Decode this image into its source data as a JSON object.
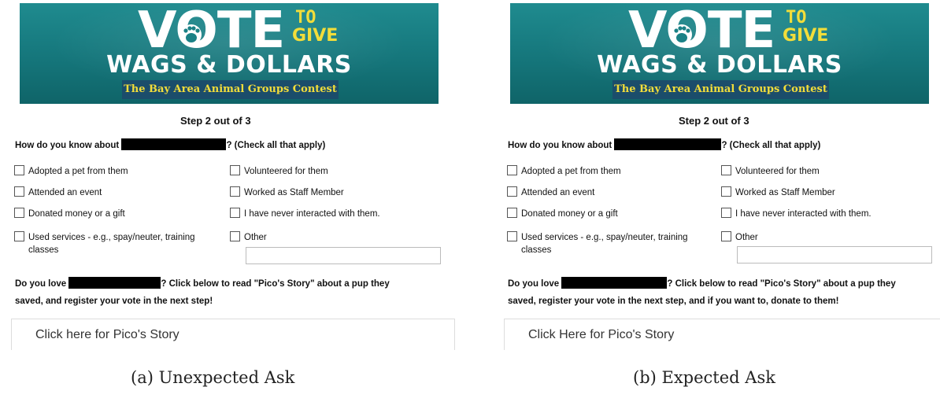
{
  "panels": [
    {
      "banner": {
        "vote": "VOTE",
        "to": "TO",
        "give": "GIVE",
        "wags": "WAGS & DOLLARS",
        "contest": "The Bay Area Animal Groups Contest"
      },
      "step": "Step 2 out of 3",
      "question_before": "How do you know about",
      "question_after": "? (Check all that apply)",
      "options_left": [
        {
          "label": "Adopted a pet from them"
        },
        {
          "label": "Attended an event"
        },
        {
          "label": "Donated money or a gift"
        },
        {
          "label": "Used services - e.g., spay/neuter, training",
          "cont": "classes"
        }
      ],
      "options_right": [
        {
          "label": "Volunteered for them"
        },
        {
          "label": "Worked as Staff Member"
        },
        {
          "label": "I have never interacted with them."
        },
        {
          "label": "Other"
        }
      ],
      "love_before": "Do you love",
      "love_after": "? Click below to read \"Pico's Story\" about a pup they",
      "love_line2": "saved, and register your vote in the next step!",
      "story_button": "Click here for Pico's Story"
    },
    {
      "banner": {
        "vote": "VOTE",
        "to": "TO",
        "give": "GIVE",
        "wags": "WAGS & DOLLARS",
        "contest": "The Bay Area Animal Groups Contest"
      },
      "step": "Step 2 out of 3",
      "question_before": "How do you know about",
      "question_after": "? (Check all that apply)",
      "options_left": [
        {
          "label": "Adopted a pet from them"
        },
        {
          "label": "Attended an event"
        },
        {
          "label": "Donated money or a gift"
        },
        {
          "label": "Used services - e.g., spay/neuter, training",
          "cont": "classes"
        }
      ],
      "options_right": [
        {
          "label": "Volunteered for them"
        },
        {
          "label": "Worked as Staff Member"
        },
        {
          "label": "I have never interacted with them."
        },
        {
          "label": "Other"
        }
      ],
      "love_before": "Do you love",
      "love_after": "? Click below to read \"Pico's Story\" about a pup they",
      "love_line2": "saved, register your vote in the next step, and if you want to, donate to them!",
      "story_button": "Click Here for Pico's Story"
    }
  ],
  "captions": [
    "(a) Unexpected Ask",
    "(b) Expected Ask"
  ],
  "colors": {
    "banner_teal": "#1a8186",
    "banner_yellow": "#f2dd3a",
    "banner_strip": "#1b4d6b",
    "redaction": "#000000"
  }
}
